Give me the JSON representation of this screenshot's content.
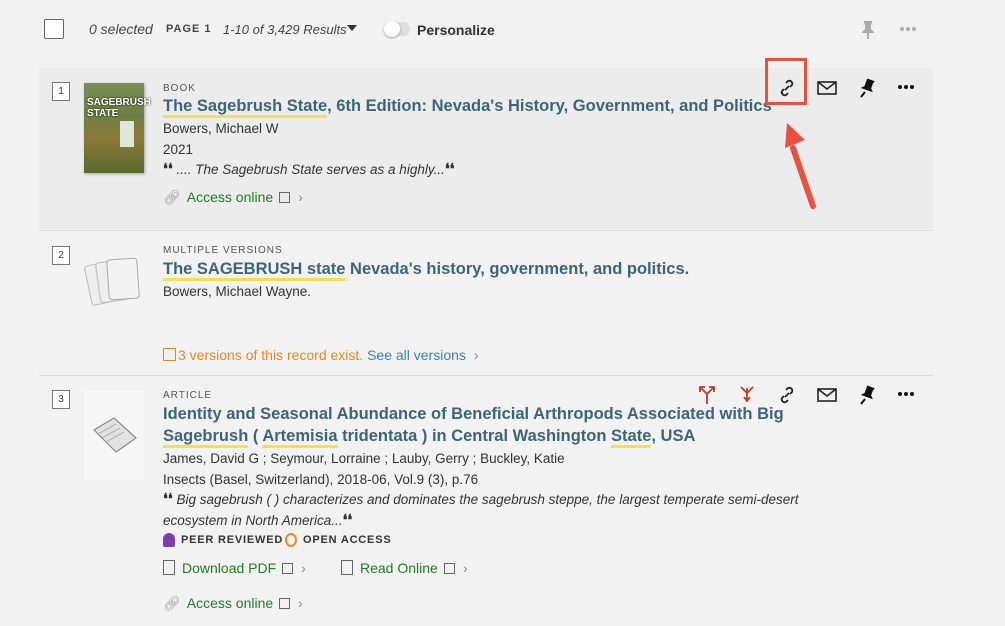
{
  "toolbar": {
    "selected": "0 selected",
    "page": "PAGE 1",
    "results": "1-10 of 3,429 Results",
    "personalize": "Personalize"
  },
  "results": [
    {
      "num": "1",
      "type": "BOOK",
      "title_mark": "The Sagebrush State",
      "title_rest": ", 6th Edition: Nevada's History, Government, and Politics",
      "author": "Bowers, Michael W",
      "year": "2021",
      "snippet": ".... The Sagebrush State serves as a highly...",
      "access": "Access online",
      "cover_text": "SAGEBRUSH STATE"
    },
    {
      "num": "2",
      "type": "MULTIPLE VERSIONS",
      "title_mark": "The SAGEBRUSH state",
      "title_rest": " Nevada's history, government, and politics.",
      "author": "Bowers, Michael Wayne.",
      "versions": "3 versions of this record exist.",
      "see_all": "See all versions"
    },
    {
      "num": "3",
      "type": "ARTICLE",
      "title_line1": "Identity and Seasonal Abundance of Beneficial Arthropods Associated with Big",
      "title_l2_a": "Sagebrush",
      "title_l2_b": " ( ",
      "title_l2_c": "Artemisia",
      "title_l2_d": " tridentata ) in Central Washington ",
      "title_l2_e": "State",
      "title_l2_f": ", USA",
      "authors": "James, David G ; Seymour, Lorraine ; Lauby, Gerry ; Buckley, Katie",
      "source": "Insects (Basel, Switzerland), 2018-06, Vol.9 (3), p.76",
      "snippet1": "Big sagebrush ( ) characterizes and dominates the sagebrush steppe, the largest temperate semi-desert",
      "snippet2": "ecosystem in North America...",
      "peer": "PEER REVIEWED",
      "open": "OPEN ACCESS",
      "download": "Download PDF",
      "read": "Read Online",
      "access": "Access online"
    }
  ],
  "colors": {
    "title": "#3d6578",
    "highlight": "#f5df4d",
    "link_green": "#227a22",
    "annotation_red": "#e8513e",
    "versions_orange": "#e08a1e"
  }
}
